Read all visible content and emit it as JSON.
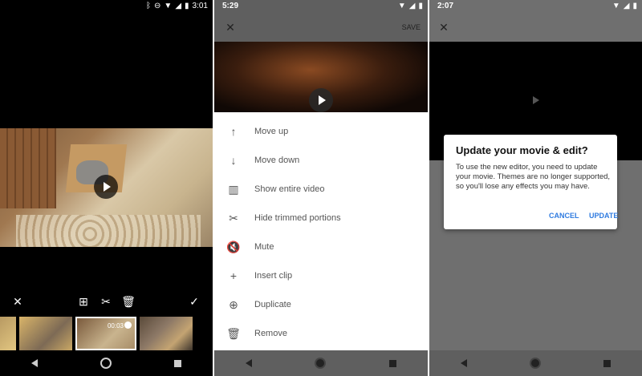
{
  "panel1": {
    "status_time": "3:01",
    "thumb_duration": "00:03",
    "toolbar_icons": [
      "close-icon",
      "add-clip-icon",
      "scissors-icon",
      "trash-icon",
      "check-icon"
    ]
  },
  "panel2": {
    "status_time": "5:29",
    "save_label": "SAVE",
    "menu": [
      {
        "label": "Move up",
        "icon": "arrow-up-icon",
        "glyph": "↑"
      },
      {
        "label": "Move down",
        "icon": "arrow-down-icon",
        "glyph": "↓"
      },
      {
        "label": "Show entire video",
        "icon": "film-icon",
        "glyph": "▥"
      },
      {
        "label": "Hide trimmed portions",
        "icon": "scissors-icon",
        "glyph": "✂"
      },
      {
        "label": "Mute",
        "icon": "mute-icon",
        "glyph": "🔇"
      },
      {
        "label": "Insert clip",
        "icon": "plus-icon",
        "glyph": "+"
      },
      {
        "label": "Duplicate",
        "icon": "duplicate-icon",
        "glyph": "⊕"
      },
      {
        "label": "Remove",
        "icon": "trash-icon",
        "glyph": "🗑"
      }
    ]
  },
  "panel3": {
    "status_time": "2:07",
    "dialog": {
      "title": "Update your movie & edit?",
      "body": "To use the new editor, you need to update your movie. Themes are no longer supported, so you'll lose any effects you may have.",
      "cancel_label": "CANCEL",
      "update_label": "UPDATE"
    }
  },
  "colors": {
    "accent": "#2f7be0",
    "toolbar_gray": "#5f5f5f",
    "scrim": "#6f6f6f"
  }
}
